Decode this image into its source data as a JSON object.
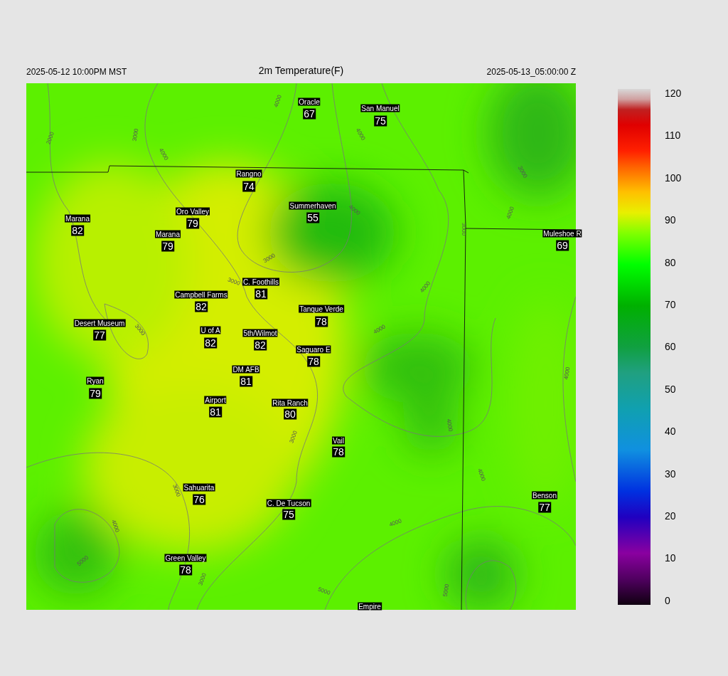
{
  "header": {
    "left_time": "2025-05-12 10:00PM MST",
    "title": "2m Temperature(F)",
    "right_time": "2025-05-13_05:00:00 Z"
  },
  "stations": [
    {
      "name": "Oracle",
      "value": "67"
    },
    {
      "name": "San Manuel",
      "value": "75"
    },
    {
      "name": "Rangno",
      "value": "74"
    },
    {
      "name": "Summerhaven",
      "value": "55"
    },
    {
      "name": "Marana",
      "value": "82"
    },
    {
      "name": "Oro Valley",
      "value": "79"
    },
    {
      "name": "Marana",
      "value": "79"
    },
    {
      "name": "Muleshoe R",
      "value": "69"
    },
    {
      "name": "C. Foothills",
      "value": "81"
    },
    {
      "name": "Campbell Farms",
      "value": "82"
    },
    {
      "name": "Tanque Verde",
      "value": "78"
    },
    {
      "name": "Desert Museum",
      "value": "77"
    },
    {
      "name": "U of A",
      "value": "82"
    },
    {
      "name": "5th/Wilmot",
      "value": "82"
    },
    {
      "name": "Saguaro E",
      "value": "78"
    },
    {
      "name": "DM AFB",
      "value": "81"
    },
    {
      "name": "Ryan",
      "value": "79"
    },
    {
      "name": "Airport",
      "value": "81"
    },
    {
      "name": "Rita Ranch",
      "value": "80"
    },
    {
      "name": "Vail",
      "value": "78"
    },
    {
      "name": "Sahuarita",
      "value": "76"
    },
    {
      "name": "Benson",
      "value": "77"
    },
    {
      "name": "C. De Tucson",
      "value": "75"
    },
    {
      "name": "Green Valley",
      "value": "78"
    },
    {
      "name": "Empire"
    }
  ],
  "contour_labels": [
    "2000",
    "3000",
    "4000",
    "4000",
    "4000",
    "4000",
    "3000",
    "4000",
    "3000",
    "3000",
    "3000",
    "4000",
    "3000",
    "4000",
    "4000",
    "3000",
    "4000",
    "4000",
    "3000",
    "4000",
    "4000",
    "5000",
    "3000",
    "5000",
    "5000"
  ],
  "colorbar": {
    "ticks": [
      "120",
      "110",
      "100",
      "90",
      "80",
      "70",
      "60",
      "50",
      "40",
      "30",
      "20",
      "10",
      "0"
    ]
  }
}
